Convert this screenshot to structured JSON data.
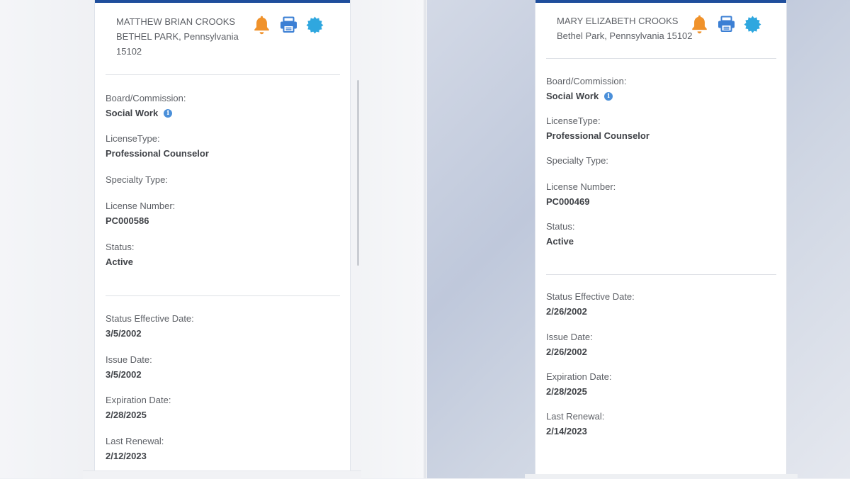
{
  "records": [
    {
      "name": "MATTHEW BRIAN CROOKS",
      "address_line": "BETHEL PARK, Pennsylvania",
      "zip": "15102",
      "icons": [
        "bell-icon",
        "printer-icon",
        "verified-badge-icon"
      ],
      "board_label": "Board/Commission:",
      "board_value": "Social Work",
      "license_type_label": "LicenseType:",
      "license_type_value": "Professional Counselor",
      "specialty_label": "Specialty Type:",
      "specialty_value": "",
      "license_number_label": "License Number:",
      "license_number_value": "PC000586",
      "status_label": "Status:",
      "status_value": "Active",
      "status_effective_label": "Status Effective Date:",
      "status_effective_value": "3/5/2002",
      "issue_label": "Issue Date:",
      "issue_value": "3/5/2002",
      "expiration_label": "Expiration Date:",
      "expiration_value": "2/28/2025",
      "renewal_label": "Last Renewal:",
      "renewal_value": "2/12/2023"
    },
    {
      "name": "MARY ELIZABETH CROOKS",
      "address_line": "Bethel Park, Pennsylvania 15102",
      "icons": [
        "bell-icon",
        "printer-icon",
        "verified-badge-icon"
      ],
      "board_label": "Board/Commission:",
      "board_value": "Social Work",
      "license_type_label": "LicenseType:",
      "license_type_value": "Professional Counselor",
      "specialty_label": "Specialty Type:",
      "specialty_value": "",
      "license_number_label": "License Number:",
      "license_number_value": "PC000469",
      "status_label": "Status:",
      "status_value": "Active",
      "status_effective_label": "Status Effective Date:",
      "status_effective_value": "2/26/2002",
      "issue_label": "Issue Date:",
      "issue_value": "2/26/2002",
      "expiration_label": "Expiration Date:",
      "expiration_value": "2/28/2025",
      "renewal_label": "Last Renewal:",
      "renewal_value": "2/14/2023"
    }
  ],
  "colors": {
    "accent_bar": "#1f4e9c",
    "bell": "#f0922b",
    "printer": "#3b7fd4",
    "badge": "#2fa7df",
    "info": "#4a8fd9"
  }
}
